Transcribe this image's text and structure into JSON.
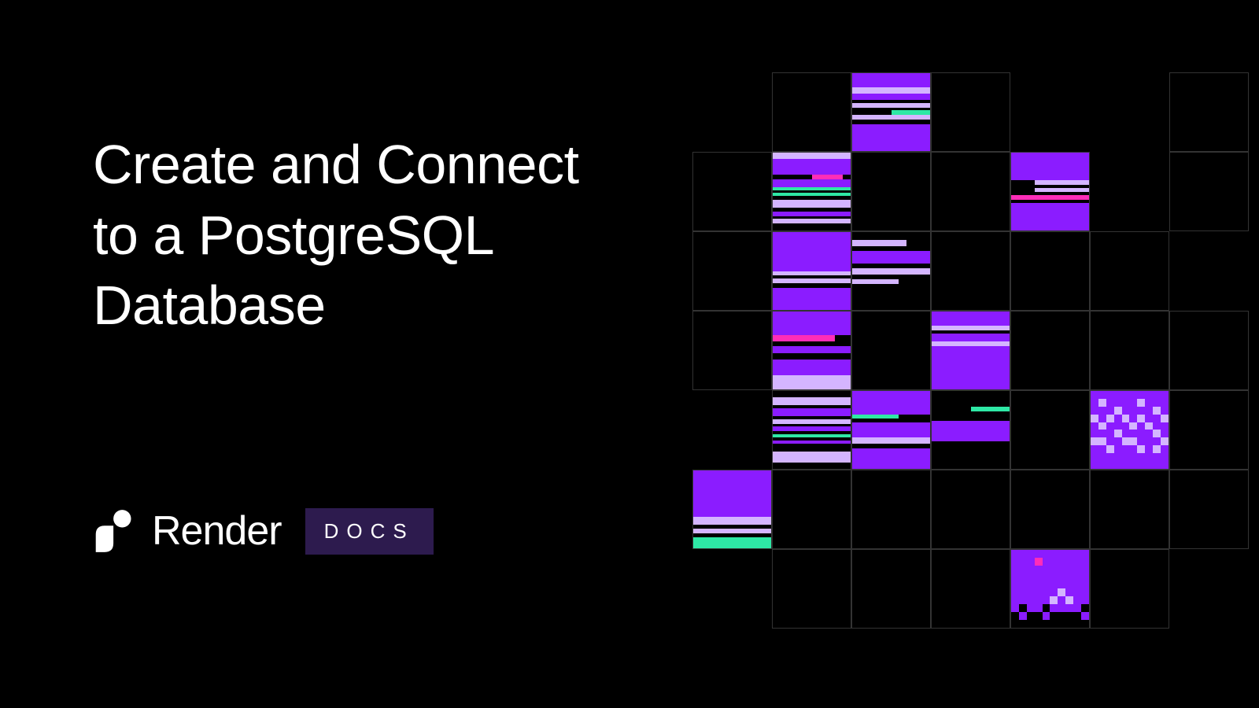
{
  "title_line1": "Create and Connect",
  "title_line2": "to a PostgreSQL",
  "title_line3": "Database",
  "brand": {
    "name": "Render",
    "badge": "DOCS"
  },
  "colors": {
    "purple": "#8b1cff",
    "lilac": "#d4b5ff",
    "mint": "#2ee8a5",
    "pink": "#ff2db8",
    "badge_bg": "#2d1b4e"
  }
}
